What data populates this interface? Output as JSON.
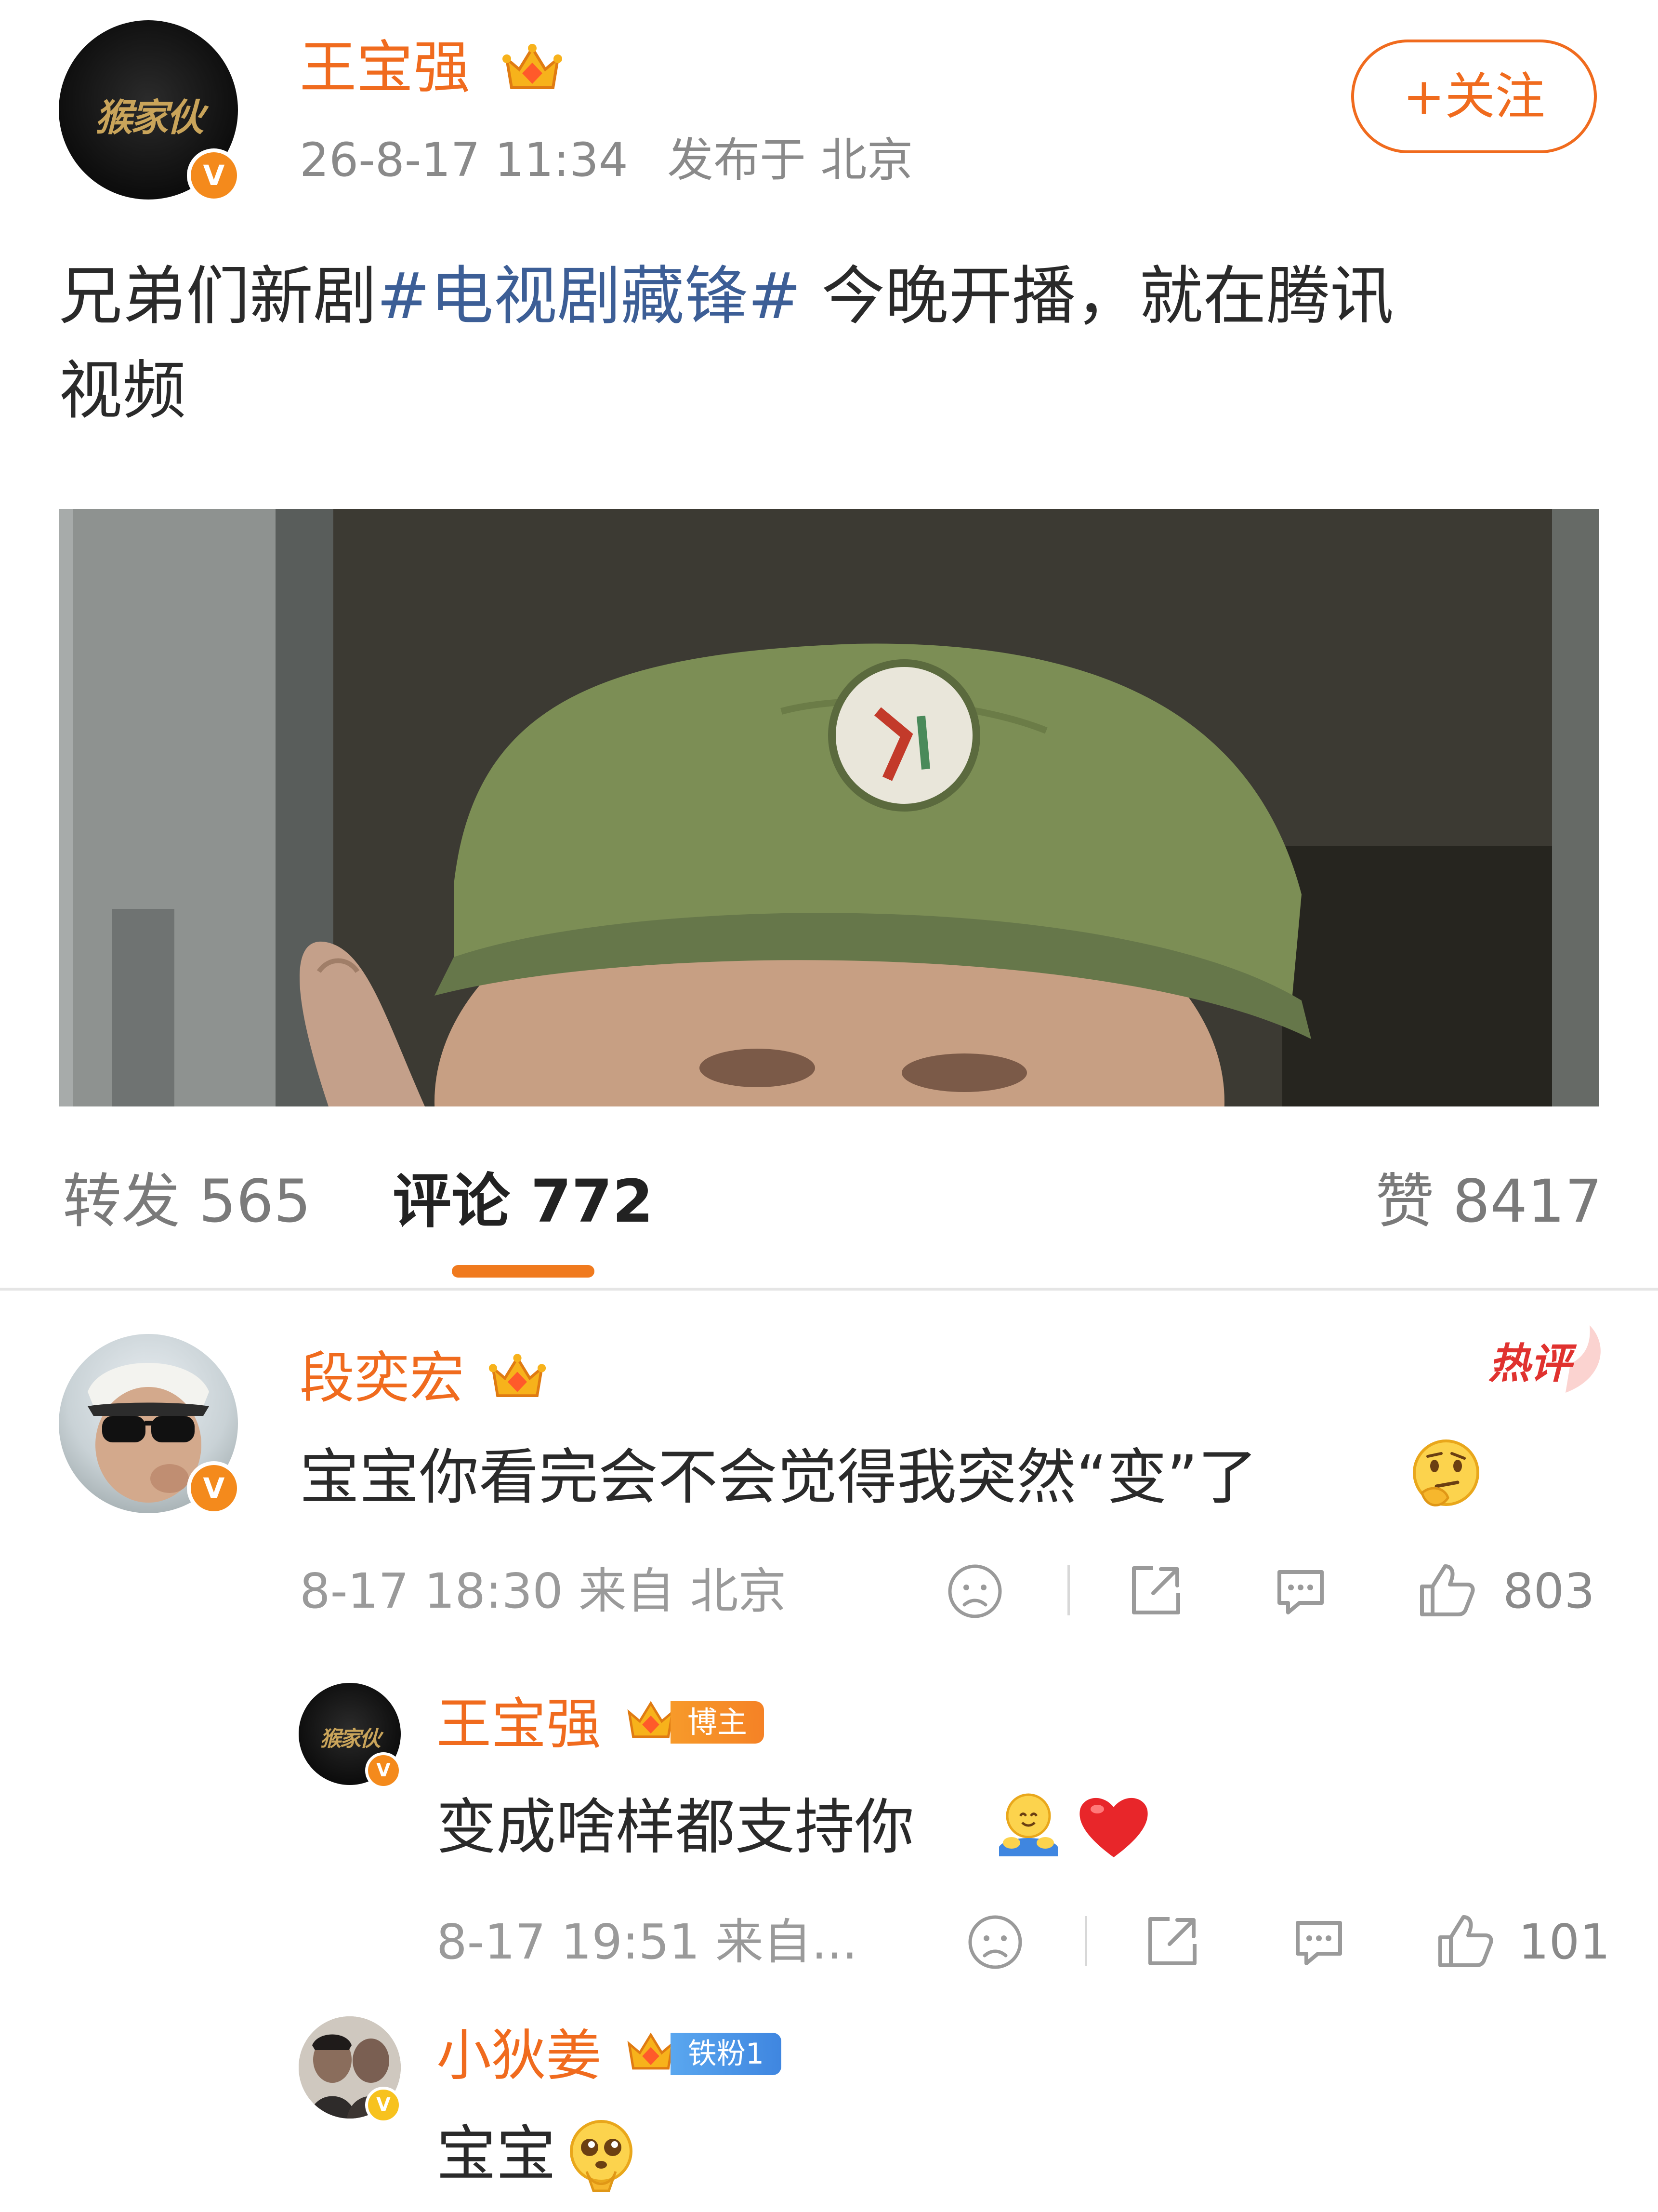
{
  "post": {
    "author_name": "王宝强",
    "timestamp": "26-8-17 11:34",
    "location": "发布于 北京",
    "follow_label": "+关注",
    "text_before": "兄弟们新剧",
    "hashtag": "#电视剧藏锋#",
    "text_after_line1": " 今晚开播，就在腾讯",
    "text_line2": "视频",
    "avatar_text": "猴家伙"
  },
  "tabs": {
    "repost": "转发 565",
    "comment": "评论 772",
    "like": "赞 8417"
  },
  "colors": {
    "accent": "#f06b1e",
    "hashtag": "#3c5e96",
    "verified": "#f48a1c",
    "hot_badge": "#e0322f",
    "heart": "#e8262a"
  },
  "comments": [
    {
      "name": "段奕宏",
      "hot_label": "热评",
      "text": "宝宝你看完会不会觉得我突然“变”了",
      "emoji": "thinking-face-icon",
      "meta": "8-17 18:30 来自 北京",
      "likes": "803"
    },
    {
      "name": "王宝强",
      "badge": "博主",
      "text": "变成啥样都支持你",
      "emoji": "hug-emoji-icon, red-heart-icon",
      "meta": "8-17 19:51 来自...",
      "likes": "101",
      "avatar_text": "猴家伙"
    },
    {
      "name": "小狄姜",
      "badge": "铁粉1",
      "text": "宝宝",
      "emoji": "pleading-face-icon"
    }
  ]
}
